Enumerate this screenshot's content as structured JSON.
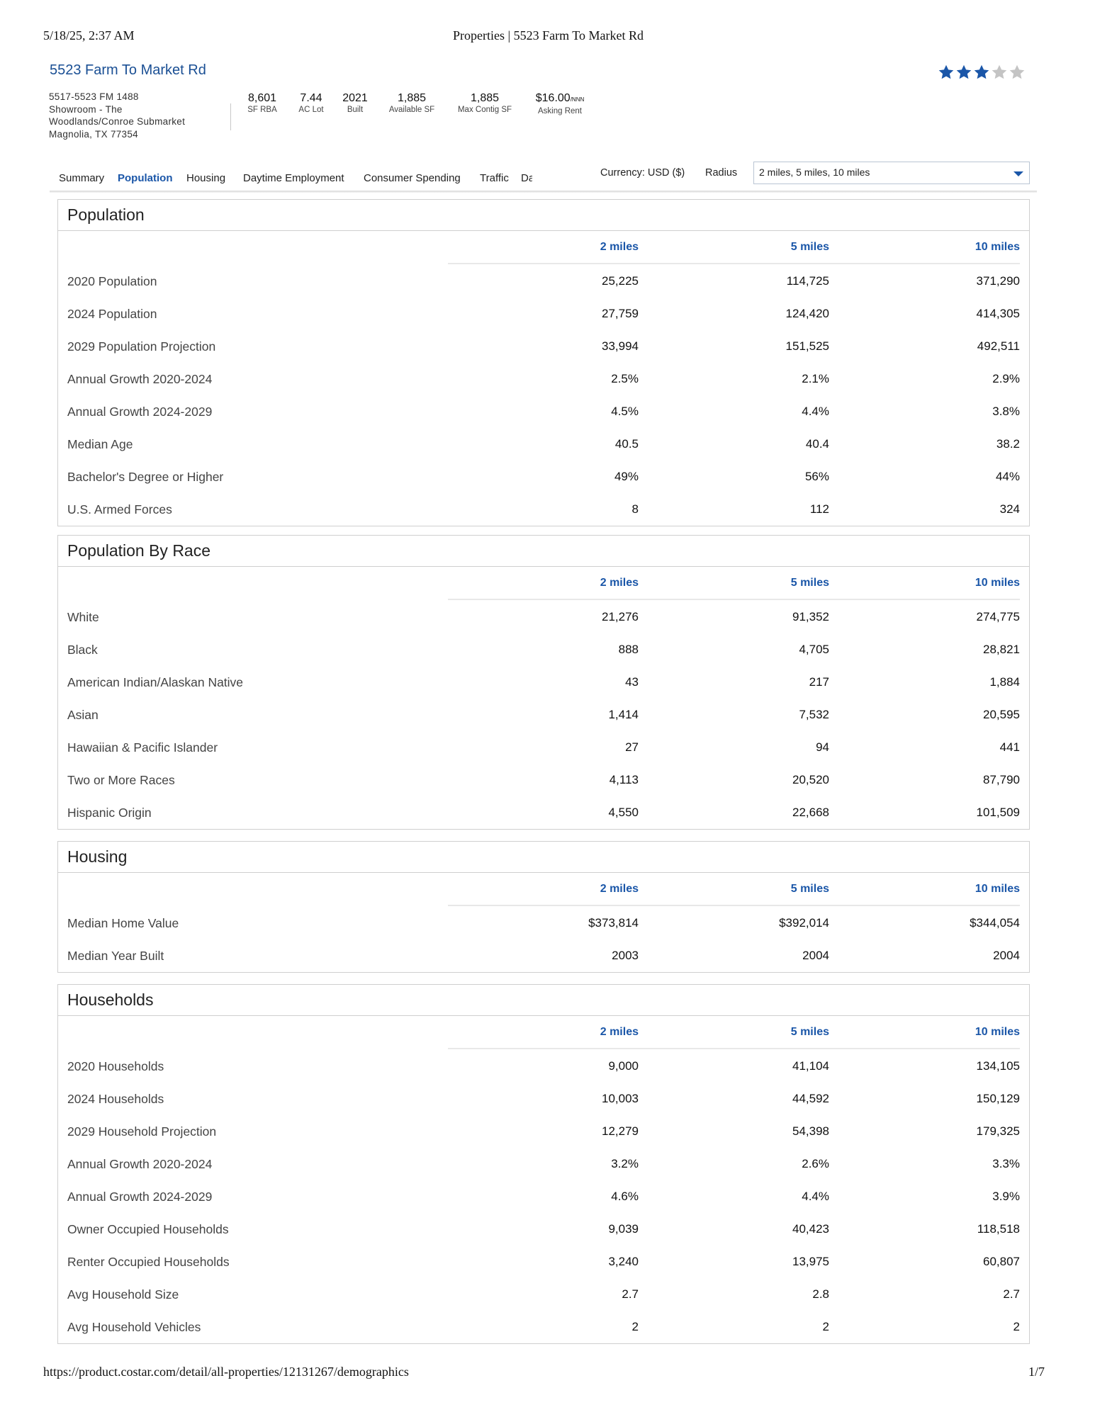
{
  "print_header": {
    "datetime": "5/18/25, 2:37 AM",
    "title": "Properties | 5523 Farm To Market Rd"
  },
  "property": {
    "name": "5523 Farm To Market Rd",
    "rating": 3,
    "rating_max": 5,
    "address": [
      "5517-5523 FM 1488",
      "Showroom - The",
      "Woodlands/Conroe Submarket",
      "Magnolia, TX 77354"
    ]
  },
  "stats": [
    {
      "value": "8,601",
      "unit": "",
      "label": "SF RBA"
    },
    {
      "value": "7.44",
      "unit": "",
      "label": "AC Lot"
    },
    {
      "value": "2021",
      "unit": "",
      "label": "Built"
    },
    {
      "value": "1,885",
      "unit": "",
      "label": "Available SF"
    },
    {
      "value": "1,885",
      "unit": "",
      "label": "Max Contig SF"
    },
    {
      "value": "$16.00",
      "unit": "/NNN",
      "label": "Asking Rent"
    }
  ],
  "tabs": [
    {
      "label": "Summary",
      "active": false
    },
    {
      "label": "Population",
      "active": true
    },
    {
      "label": "Housing",
      "active": false
    },
    {
      "label": "Daytime Employment",
      "active": false
    },
    {
      "label": "Consumer Spending",
      "active": false
    },
    {
      "label": "Traffic",
      "active": false
    },
    {
      "label": "Da",
      "active": false
    }
  ],
  "controls": {
    "currency": "Currency: USD ($)",
    "radius_label": "Radius",
    "radius_value": "2 miles, 5 miles, 10 miles"
  },
  "columns": [
    "2 miles",
    "5 miles",
    "10 miles"
  ],
  "sections": [
    {
      "title": "Population",
      "rows": [
        {
          "label": "2020 Population",
          "values": [
            "25,225",
            "114,725",
            "371,290"
          ]
        },
        {
          "label": "2024 Population",
          "values": [
            "27,759",
            "124,420",
            "414,305"
          ]
        },
        {
          "label": "2029 Population Projection",
          "values": [
            "33,994",
            "151,525",
            "492,511"
          ]
        },
        {
          "label": "Annual Growth 2020-2024",
          "values": [
            "2.5%",
            "2.1%",
            "2.9%"
          ]
        },
        {
          "label": "Annual Growth 2024-2029",
          "values": [
            "4.5%",
            "4.4%",
            "3.8%"
          ]
        },
        {
          "label": "Median Age",
          "values": [
            "40.5",
            "40.4",
            "38.2"
          ]
        },
        {
          "label": "Bachelor's Degree or Higher",
          "values": [
            "49%",
            "56%",
            "44%"
          ]
        },
        {
          "label": "U.S. Armed Forces",
          "values": [
            "8",
            "112",
            "324"
          ]
        }
      ]
    },
    {
      "title": "Population By Race",
      "rows": [
        {
          "label": "White",
          "values": [
            "21,276",
            "91,352",
            "274,775"
          ]
        },
        {
          "label": "Black",
          "values": [
            "888",
            "4,705",
            "28,821"
          ]
        },
        {
          "label": "American Indian/Alaskan Native",
          "values": [
            "43",
            "217",
            "1,884"
          ]
        },
        {
          "label": "Asian",
          "values": [
            "1,414",
            "7,532",
            "20,595"
          ]
        },
        {
          "label": "Hawaiian & Pacific Islander",
          "values": [
            "27",
            "94",
            "441"
          ]
        },
        {
          "label": "Two or More Races",
          "values": [
            "4,113",
            "20,520",
            "87,790"
          ]
        },
        {
          "label": "Hispanic Origin",
          "values": [
            "4,550",
            "22,668",
            "101,509"
          ]
        }
      ]
    },
    {
      "title": "Housing",
      "rows": [
        {
          "label": "Median Home Value",
          "values": [
            "$373,814",
            "$392,014",
            "$344,054"
          ]
        },
        {
          "label": "Median Year Built",
          "values": [
            "2003",
            "2004",
            "2004"
          ]
        }
      ]
    },
    {
      "title": "Households",
      "rows": [
        {
          "label": "2020 Households",
          "values": [
            "9,000",
            "41,104",
            "134,105"
          ]
        },
        {
          "label": "2024 Households",
          "values": [
            "10,003",
            "44,592",
            "150,129"
          ]
        },
        {
          "label": "2029 Household Projection",
          "values": [
            "12,279",
            "54,398",
            "179,325"
          ]
        },
        {
          "label": "Annual Growth 2020-2024",
          "values": [
            "3.2%",
            "2.6%",
            "3.3%"
          ]
        },
        {
          "label": "Annual Growth 2024-2029",
          "values": [
            "4.6%",
            "4.4%",
            "3.9%"
          ]
        },
        {
          "label": "Owner Occupied Households",
          "values": [
            "9,039",
            "40,423",
            "118,518"
          ]
        },
        {
          "label": "Renter Occupied Households",
          "values": [
            "3,240",
            "13,975",
            "60,807"
          ]
        },
        {
          "label": "Avg Household Size",
          "values": [
            "2.7",
            "2.8",
            "2.7"
          ]
        },
        {
          "label": "Avg Household Vehicles",
          "values": [
            "2",
            "2",
            "2"
          ]
        }
      ]
    }
  ],
  "print_footer": {
    "url": "https://product.costar.com/detail/all-properties/12131267/demographics",
    "page": "1/7"
  },
  "colors": {
    "link": "#1a4f94",
    "accent": "#1a56a8",
    "star_on": "#1a56a8",
    "star_off": "#c4c4c4"
  }
}
